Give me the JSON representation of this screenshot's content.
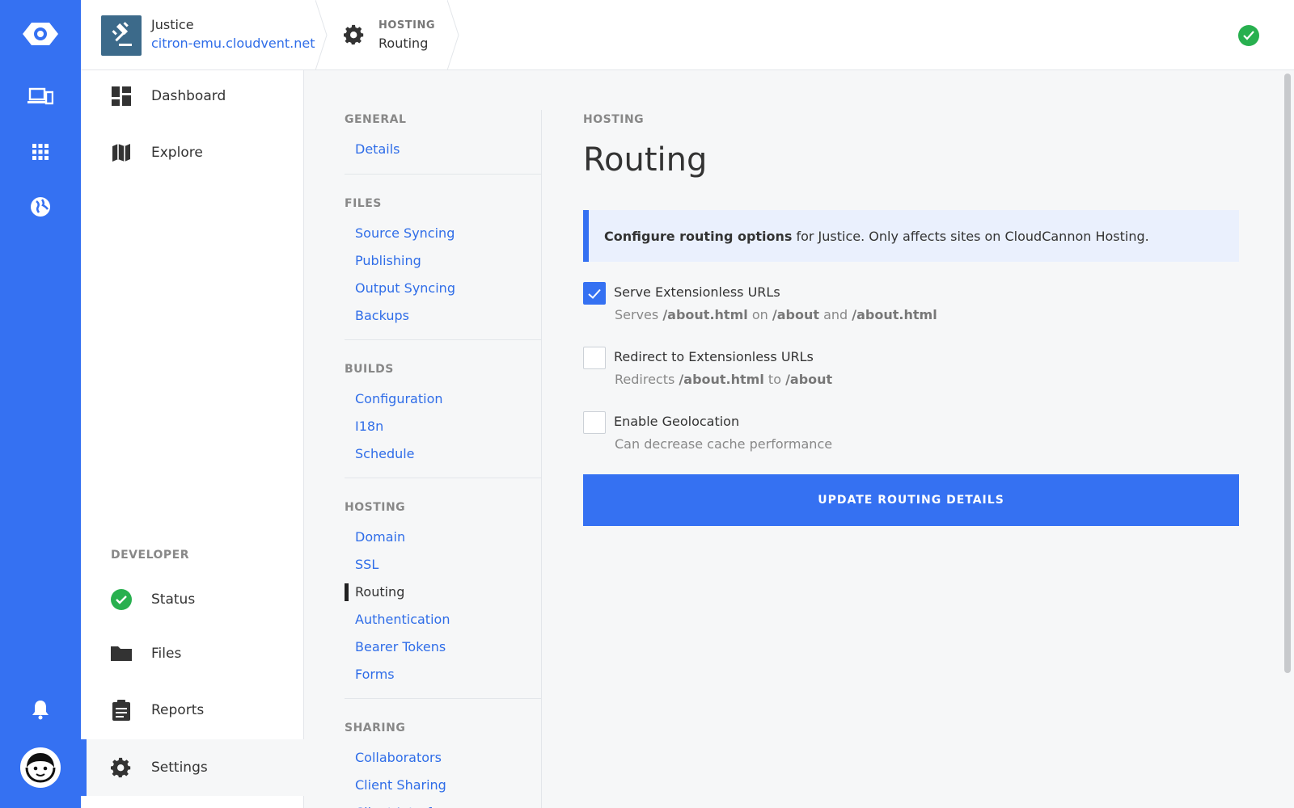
{
  "site": {
    "name": "Justice",
    "url": "citron-emu.cloudvent.net"
  },
  "breadcrumb": {
    "section": "HOSTING",
    "title": "Routing"
  },
  "primary_nav": {
    "items": [
      {
        "label": "Dashboard",
        "icon": "dashboard-icon"
      },
      {
        "label": "Explore",
        "icon": "map-icon"
      }
    ],
    "developer_heading": "DEVELOPER",
    "developer_items": [
      {
        "label": "Status",
        "icon": "status-check-icon"
      },
      {
        "label": "Files",
        "icon": "folder-icon"
      },
      {
        "label": "Reports",
        "icon": "clipboard-icon"
      },
      {
        "label": "Settings",
        "icon": "gear-icon",
        "active": true
      }
    ]
  },
  "secondary_nav": {
    "groups": [
      {
        "heading": "GENERAL",
        "links": [
          "Details"
        ]
      },
      {
        "heading": "FILES",
        "links": [
          "Source Syncing",
          "Publishing",
          "Output Syncing",
          "Backups"
        ]
      },
      {
        "heading": "BUILDS",
        "links": [
          "Configuration",
          "I18n",
          "Schedule"
        ]
      },
      {
        "heading": "HOSTING",
        "links": [
          "Domain",
          "SSL",
          "Routing",
          "Authentication",
          "Bearer Tokens",
          "Forms"
        ]
      },
      {
        "heading": "SHARING",
        "links": [
          "Collaborators",
          "Client Sharing",
          "Client Interf..."
        ]
      }
    ],
    "active": "Routing"
  },
  "main": {
    "eyebrow": "HOSTING",
    "title": "Routing",
    "callout": {
      "strong": "Configure routing options",
      "text": "for Justice. Only affects sites on CloudCannon Hosting."
    },
    "options": [
      {
        "label": "Serve Extensionless URLs",
        "checked": true,
        "help": {
          "p1": "Serves",
          "b1": "/about.html",
          "p2": "on",
          "b2": "/about",
          "p3": "and",
          "b3": "/about.html"
        }
      },
      {
        "label": "Redirect to Extensionless URLs",
        "checked": false,
        "help": {
          "p1": "Redirects",
          "b1": "/about.html",
          "p2": "to",
          "b2": "/about"
        }
      },
      {
        "label": "Enable Geolocation",
        "checked": false,
        "help": {
          "p1": "Can decrease cache performance"
        }
      }
    ],
    "submit_label": "UPDATE ROUTING DETAILS"
  },
  "colors": {
    "accent": "#3571f2",
    "link": "#2f6de8",
    "success": "#28b04f"
  }
}
